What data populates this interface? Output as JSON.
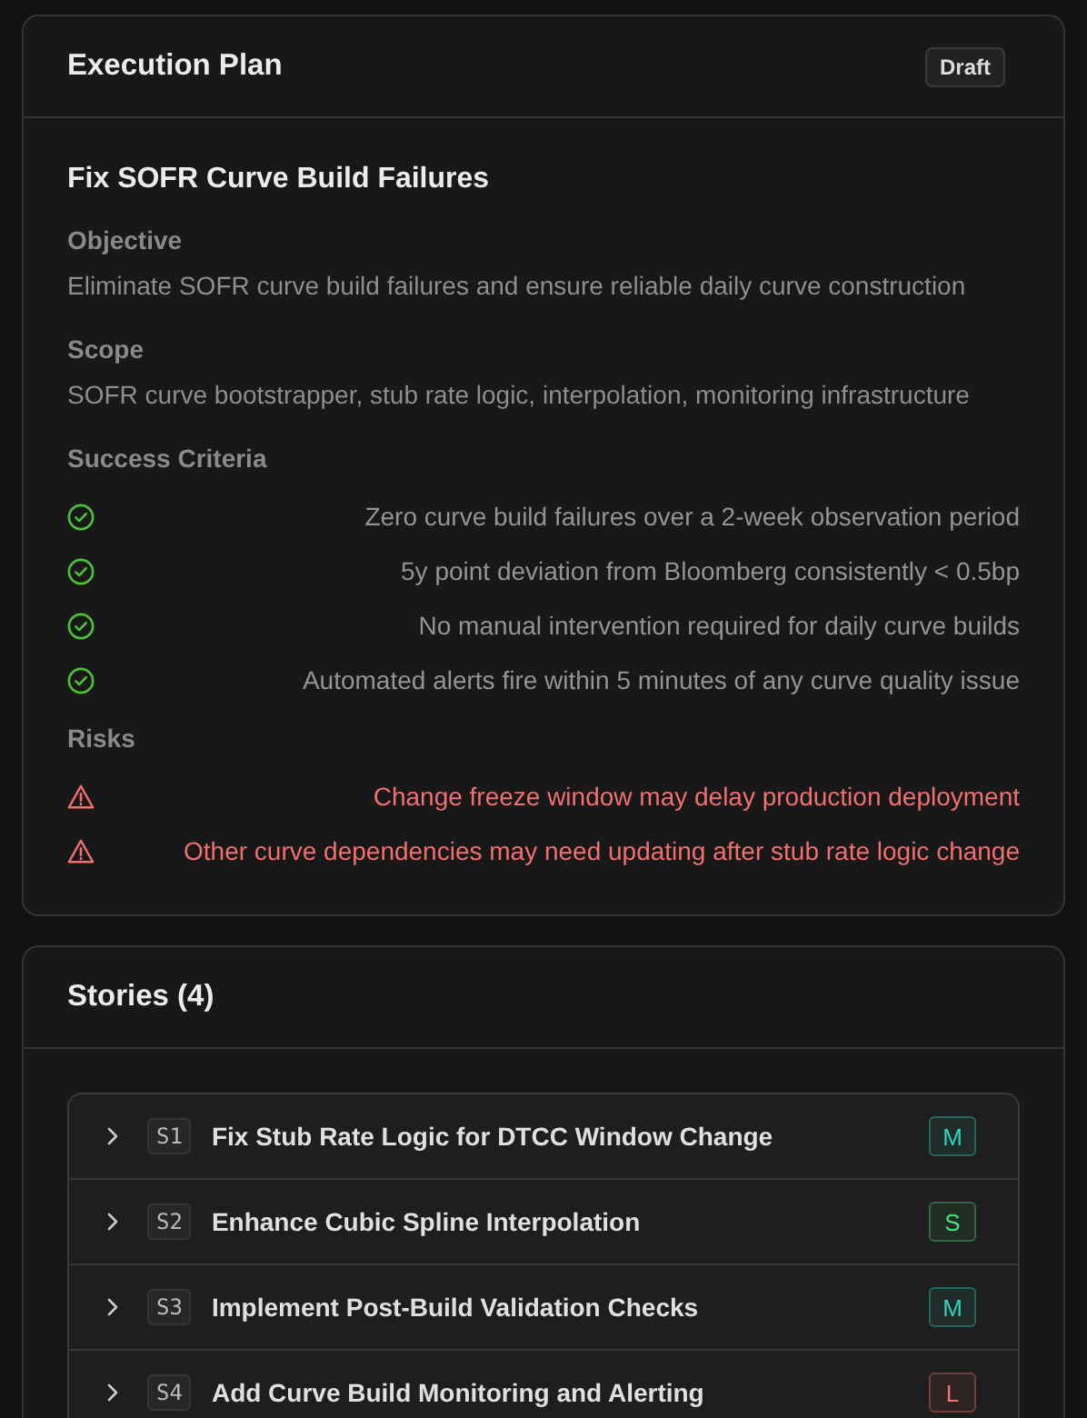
{
  "plan": {
    "title": "Execution Plan",
    "status": "Draft",
    "name": "Fix SOFR Curve Build Failures",
    "objective": {
      "label": "Objective",
      "text": "Eliminate SOFR curve build failures and ensure reliable daily curve construction"
    },
    "scope": {
      "label": "Scope",
      "text": "SOFR curve bootstrapper, stub rate logic, interpolation, monitoring infrastructure"
    },
    "success_criteria": {
      "label": "Success Criteria",
      "items": [
        "Zero curve build failures over a 2-week observation period",
        "5y point deviation from Bloomberg consistently < 0.5bp",
        "No manual intervention required for daily curve builds",
        "Automated alerts fire within 5 minutes of any curve quality issue"
      ]
    },
    "risks": {
      "label": "Risks",
      "items": [
        "Change freeze window may delay production deployment",
        "Other curve dependencies may need updating after stub rate logic change"
      ]
    }
  },
  "stories": {
    "title": "Stories (4)",
    "items": [
      {
        "id": "S1",
        "title": "Fix Stub Rate Logic for DTCC Window Change",
        "size": "M",
        "color": "#2dd4bf",
        "expanded": false
      },
      {
        "id": "S2",
        "title": "Enhance Cubic Spline Interpolation",
        "size": "S",
        "color": "#4ade80",
        "expanded": false
      },
      {
        "id": "S3",
        "title": "Implement Post-Build Validation Checks",
        "size": "M",
        "color": "#2dd4bf",
        "expanded": false
      },
      {
        "id": "S4",
        "title": "Add Curve Build Monitoring and Alerting",
        "size": "L",
        "color": "#f87171",
        "expanded": false
      }
    ]
  }
}
